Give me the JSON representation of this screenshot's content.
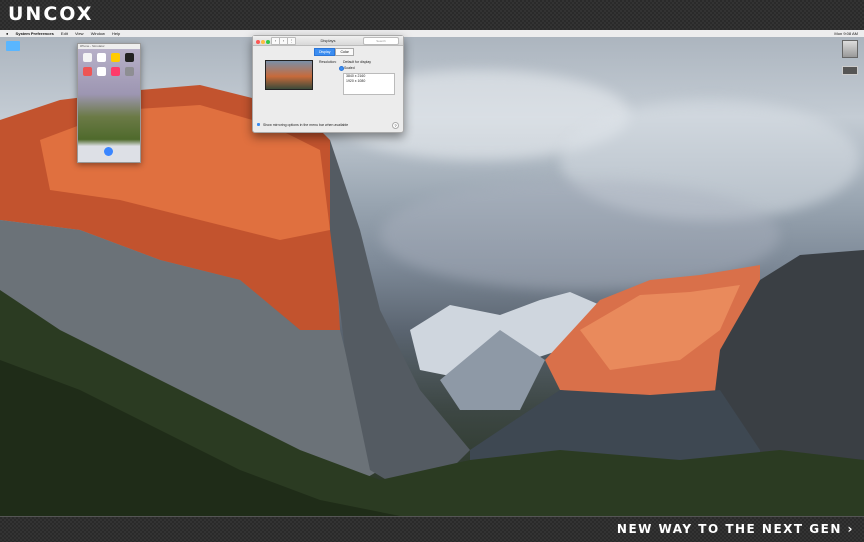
{
  "branding": {
    "logo": "UNCOX",
    "tagline": "NEW WAY TO THE NEXT GEN ›"
  },
  "menubar": {
    "app_name": "System Preferences",
    "items": [
      "Edit",
      "View",
      "Window",
      "Help"
    ],
    "clock": "Mon 9:08 AM"
  },
  "phone_window": {
    "address": "iPhone - Simulator"
  },
  "prefs_window": {
    "title": "Displays",
    "search_placeholder": "Search",
    "tabs": [
      "Display",
      "Color"
    ],
    "resolution_label": "Resolution:",
    "option_default": "Default for display",
    "option_scaled": "Scaled",
    "resolutions": [
      "3840 x 2160",
      "1920 x 1080"
    ],
    "mirror_option": "Show mirroring options in the menu bar when available",
    "help": "?"
  },
  "colors": {
    "accent": "#3b8df1",
    "close": "#fc5753",
    "minimize": "#fdbc40",
    "zoom": "#33c748"
  }
}
